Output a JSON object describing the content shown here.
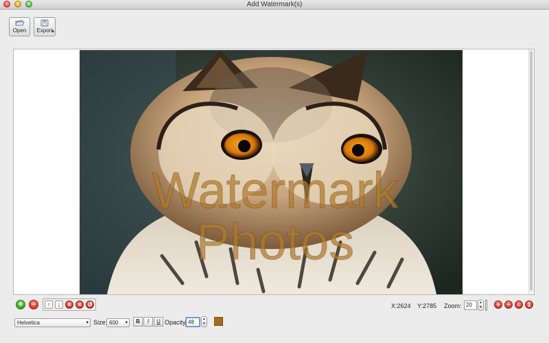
{
  "window": {
    "title": "Add Watermark(s)"
  },
  "toolbar": {
    "open_label": "Open",
    "export_label": "Export",
    "export_menu_glyph": "▾"
  },
  "canvas": {
    "watermark_line1": "Watermark",
    "watermark_line2": "Photos",
    "watermark_color": "#b07a2c",
    "image_subject": "owl"
  },
  "bottom_bar": {
    "add_glyph": "+",
    "remove_glyph": "−",
    "x_readout": "X:2624",
    "y_readout": "Y:2785",
    "zoom_label": "Zoom:",
    "zoom_value": "20"
  },
  "font_row": {
    "font_family_value": "Helvetica",
    "size_label": "Size:",
    "size_value": "600",
    "bold_label": "B",
    "italic_label": "I",
    "underline_label": "U",
    "opacity_label": "Opacity:",
    "opacity_value": "48",
    "text_color": "#a7681f"
  },
  "icons": {
    "close": "close-window-icon",
    "minimize": "minimize-window-icon",
    "zoom": "zoom-window-icon",
    "open": "open-folder-icon",
    "export": "export-disk-icon"
  }
}
